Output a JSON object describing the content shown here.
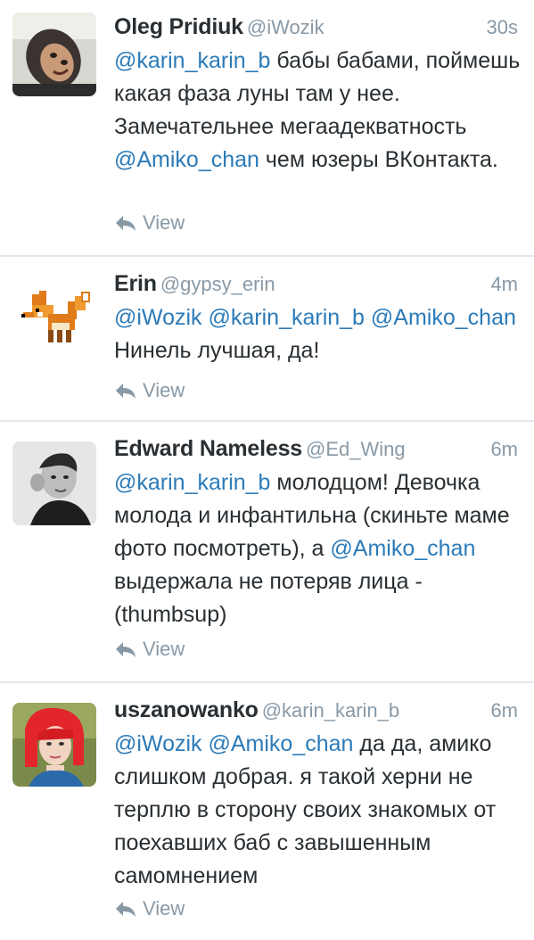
{
  "tweets": [
    {
      "name": "Oleg Pridiuk",
      "handle": "@iWozik",
      "time": "30s",
      "segments": [
        {
          "text": "@karin_karin_b",
          "mention": true
        },
        {
          "text": " бабы бабами, поймешь какая фаза луны там у нее. Замечательнее мегаадекватность ",
          "mention": false
        },
        {
          "text": "@Amiko_chan",
          "mention": true
        },
        {
          "text": " чем юзеры ВКонтакта.",
          "mention": false
        }
      ],
      "view": "View"
    },
    {
      "name": "Erin",
      "handle": "@gypsy_erin",
      "time": "4m",
      "segments": [
        {
          "text": "@iWozik",
          "mention": true
        },
        {
          "text": " ",
          "mention": false
        },
        {
          "text": "@karin_karin_b",
          "mention": true
        },
        {
          "text": " ",
          "mention": false
        },
        {
          "text": "@Amiko_chan",
          "mention": true
        },
        {
          "text": " Нинель лучшая, да!",
          "mention": false
        }
      ],
      "view": "View"
    },
    {
      "name": "Edward Nameless",
      "handle": "@Ed_Wing",
      "time": "6m",
      "segments": [
        {
          "text": "@karin_karin_b",
          "mention": true
        },
        {
          "text": " молодцом! Девочка молода и инфантильна (скиньте маме фото посмотреть), а ",
          "mention": false
        },
        {
          "text": "@Amiko_chan",
          "mention": true
        },
        {
          "text": " выдержала не потеряв лица - (thumbsup)",
          "mention": false
        }
      ],
      "view": "View"
    },
    {
      "name": "uszanowanko",
      "handle": "@karin_karin_b",
      "time": "6m",
      "segments": [
        {
          "text": "@iWozik",
          "mention": true
        },
        {
          "text": " ",
          "mention": false
        },
        {
          "text": "@Amiko_chan",
          "mention": true
        },
        {
          "text": " да да, амико слишком добрая. я такой херни не терплю в сторону своих знакомых от поехавших баб с завышенным самомнением",
          "mention": false
        }
      ],
      "view": "View"
    }
  ],
  "colors": {
    "mention": "#2b7bb9",
    "meta": "#8899a6",
    "name": "#292f33",
    "separator": "#e1e8ed"
  }
}
